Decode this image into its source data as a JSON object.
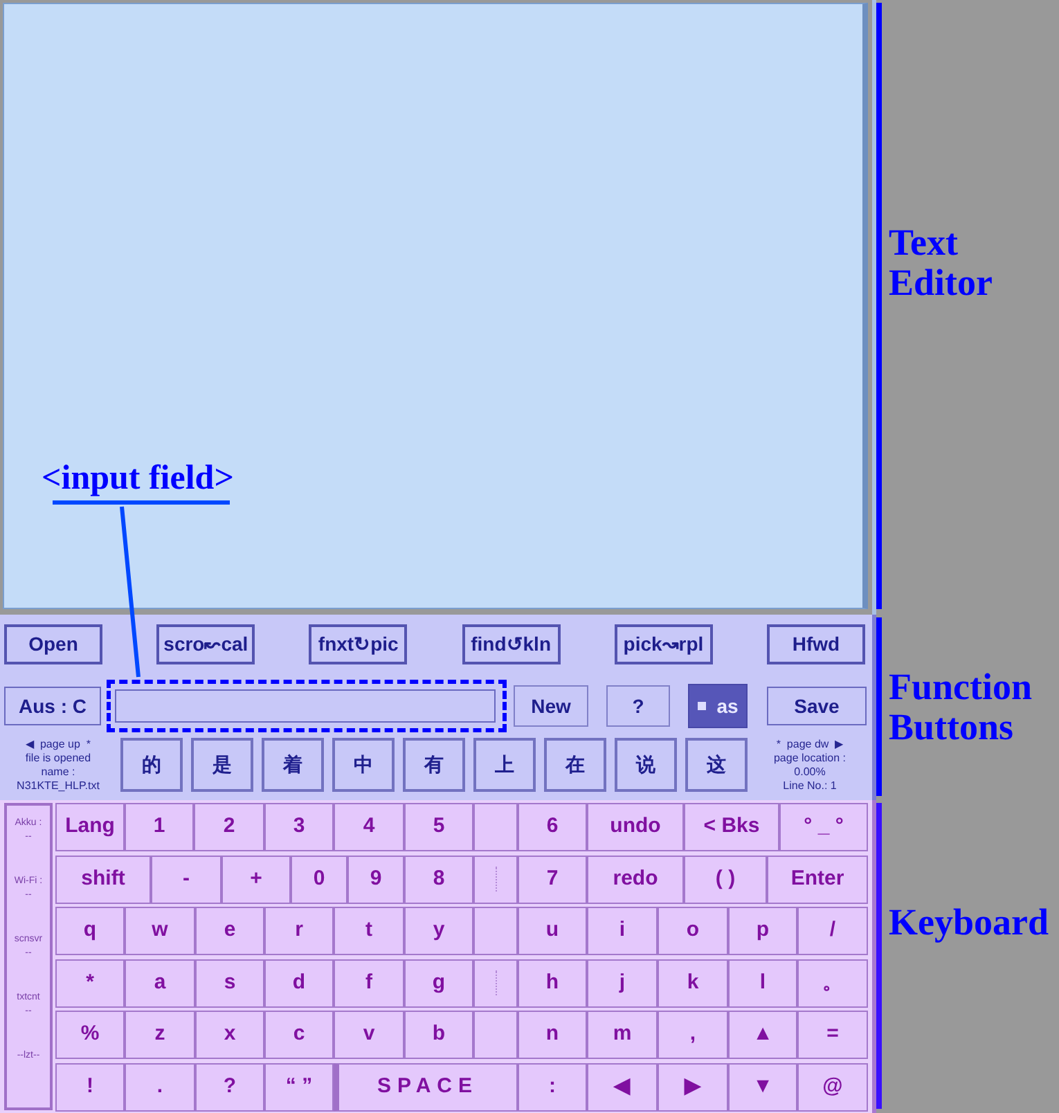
{
  "editor_callout": "<input field>",
  "function_panel": {
    "top_buttons": [
      {
        "label": "Open"
      },
      {
        "label": "scro↜cal"
      },
      {
        "label": "fnxt↻pic"
      },
      {
        "label": "find↺kln"
      },
      {
        "label": "pick↝rpl"
      },
      {
        "label": "Hfwd"
      }
    ],
    "mode_button": "Aus : C",
    "new_button": "New",
    "help_button": "?",
    "toggle": {
      "label": "as",
      "selected": true
    },
    "save_button": "Save",
    "page_up": "◀  page up  *",
    "file_info": [
      "file is opened",
      "name :",
      "N31KTE_HLP.txt"
    ],
    "char_buttons": [
      "的",
      "是",
      "着",
      "中",
      "有",
      "上",
      "在",
      "说",
      "这"
    ],
    "page_down": "*  page dw  ▶",
    "location_info": [
      "page location :",
      "0.00%",
      "Line No.: 1"
    ]
  },
  "keyboard": {
    "status": [
      {
        "label": "Akku :",
        "value": "--"
      },
      {
        "label": "Wi-Fi :",
        "value": "--"
      },
      {
        "label": "scnsvr",
        "value": "--"
      },
      {
        "label": "txtcnt",
        "value": "--"
      },
      {
        "label": "--lzt--"
      }
    ],
    "rows": [
      {
        "left": [
          {
            "kind": "key",
            "label": "Lang"
          },
          {
            "kind": "key",
            "label": "1"
          },
          {
            "kind": "key",
            "label": "2"
          },
          {
            "kind": "key",
            "label": "3"
          },
          {
            "kind": "key",
            "label": "4"
          },
          {
            "kind": "key",
            "label": "5"
          }
        ],
        "gap": {
          "kind": "blank"
        },
        "right": [
          {
            "kind": "key",
            "label": "6"
          },
          {
            "kind": "key",
            "label": "undo"
          },
          {
            "kind": "key",
            "label": "< Bks"
          },
          {
            "kind": "key",
            "label": "° _ °"
          }
        ]
      },
      {
        "left": [
          {
            "kind": "key",
            "label": "shift"
          },
          {
            "kind": "key",
            "label": "-"
          },
          {
            "kind": "key",
            "label": "+"
          },
          {
            "kind": "key",
            "label": "0"
          },
          {
            "kind": "key",
            "label": "9"
          },
          {
            "kind": "key",
            "label": "8"
          }
        ],
        "gap": {
          "kind": "dotted"
        },
        "right": [
          {
            "kind": "key",
            "label": "7"
          },
          {
            "kind": "key",
            "label": "redo"
          },
          {
            "kind": "key",
            "label": "( )"
          },
          {
            "kind": "key",
            "label": "Enter"
          }
        ]
      },
      {
        "left": [
          {
            "kind": "key",
            "label": "q"
          },
          {
            "kind": "key",
            "label": "w"
          },
          {
            "kind": "key",
            "label": "e"
          },
          {
            "kind": "key",
            "label": "r"
          },
          {
            "kind": "key",
            "label": "t"
          },
          {
            "kind": "key",
            "label": "y"
          }
        ],
        "gap": {
          "kind": "blank"
        },
        "right": [
          {
            "kind": "key",
            "label": "u"
          },
          {
            "kind": "key",
            "label": "i"
          },
          {
            "kind": "key",
            "label": "o"
          },
          {
            "kind": "key",
            "label": "p"
          },
          {
            "kind": "key",
            "label": "/"
          }
        ]
      },
      {
        "left": [
          {
            "kind": "key",
            "label": "*"
          },
          {
            "kind": "key",
            "label": "a"
          },
          {
            "kind": "key",
            "label": "s"
          },
          {
            "kind": "key",
            "label": "d"
          },
          {
            "kind": "key",
            "label": "f"
          },
          {
            "kind": "key",
            "label": "g"
          }
        ],
        "gap": {
          "kind": "dotted"
        },
        "right": [
          {
            "kind": "key",
            "label": "h"
          },
          {
            "kind": "key",
            "label": "j"
          },
          {
            "kind": "key",
            "label": "k"
          },
          {
            "kind": "key",
            "label": "l"
          },
          {
            "kind": "key",
            "label": "。"
          }
        ]
      },
      {
        "left": [
          {
            "kind": "key",
            "label": "%"
          },
          {
            "kind": "key",
            "label": "z"
          },
          {
            "kind": "key",
            "label": "x"
          },
          {
            "kind": "key",
            "label": "c"
          },
          {
            "kind": "key",
            "label": "v"
          },
          {
            "kind": "key",
            "label": "b"
          }
        ],
        "gap": {
          "kind": "blank"
        },
        "right": [
          {
            "kind": "key",
            "label": "n"
          },
          {
            "kind": "key",
            "label": "m"
          },
          {
            "kind": "key",
            "label": ","
          },
          {
            "kind": "key",
            "label": "▲"
          },
          {
            "kind": "key",
            "label": "="
          }
        ]
      },
      {
        "left": [
          {
            "kind": "key",
            "label": "!"
          },
          {
            "kind": "key",
            "label": "."
          },
          {
            "kind": "key",
            "label": "?"
          },
          {
            "kind": "key",
            "label": "“ ”"
          },
          {
            "kind": "space",
            "label": "SPACE"
          }
        ],
        "right": [
          {
            "kind": "key",
            "label": ":"
          },
          {
            "kind": "key",
            "label": "◀"
          },
          {
            "kind": "key",
            "label": "▶"
          },
          {
            "kind": "key",
            "label": "▼"
          },
          {
            "kind": "key",
            "label": "@"
          }
        ]
      }
    ]
  },
  "section_labels": [
    {
      "label": "Text Editor"
    },
    {
      "label": "Function Buttons"
    },
    {
      "label": "Keyboard"
    }
  ]
}
